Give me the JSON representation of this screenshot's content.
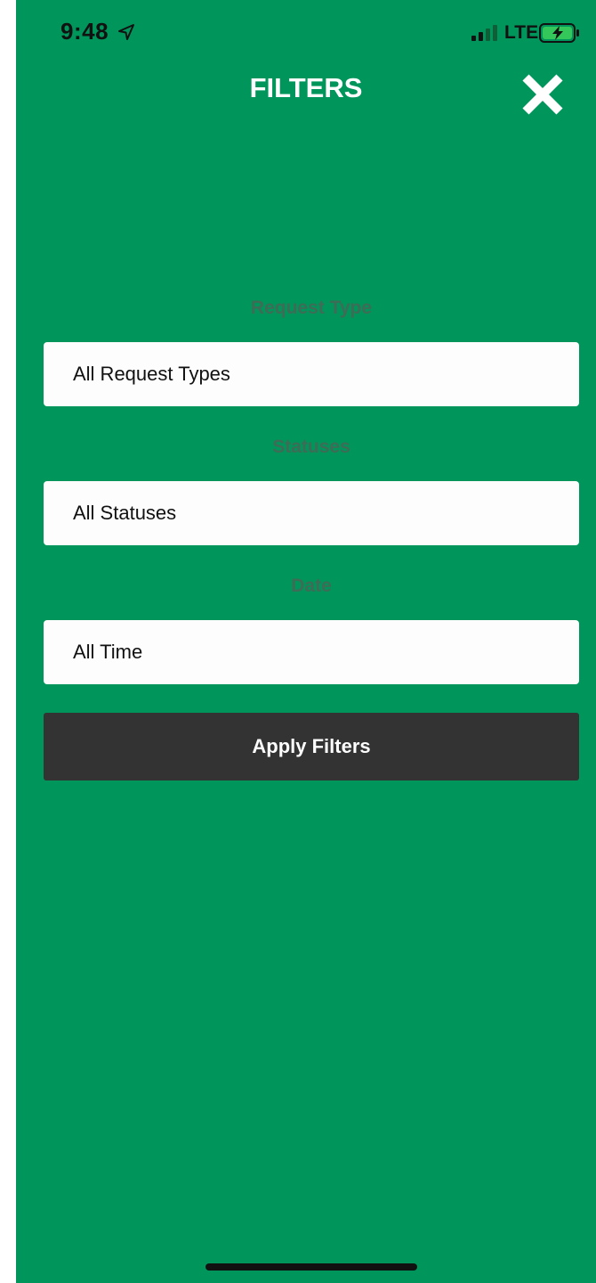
{
  "status_bar": {
    "time": "9:48",
    "network": "LTE",
    "icons": [
      "location-arrow-icon",
      "signal-icon",
      "battery-charging-icon"
    ]
  },
  "header": {
    "title": "FILTERS",
    "close_icon": "close-icon"
  },
  "filters": {
    "request_type": {
      "label": "Request Type",
      "value": "All Request Types"
    },
    "statuses": {
      "label": "Statuses",
      "value": "All Statuses"
    },
    "date": {
      "label": "Date",
      "value": "All Time"
    }
  },
  "apply_button": {
    "label": "Apply Filters"
  },
  "colors": {
    "background": "#00955b",
    "field": "#fdfdfd",
    "button": "#333333",
    "label": "#3e6c56"
  }
}
